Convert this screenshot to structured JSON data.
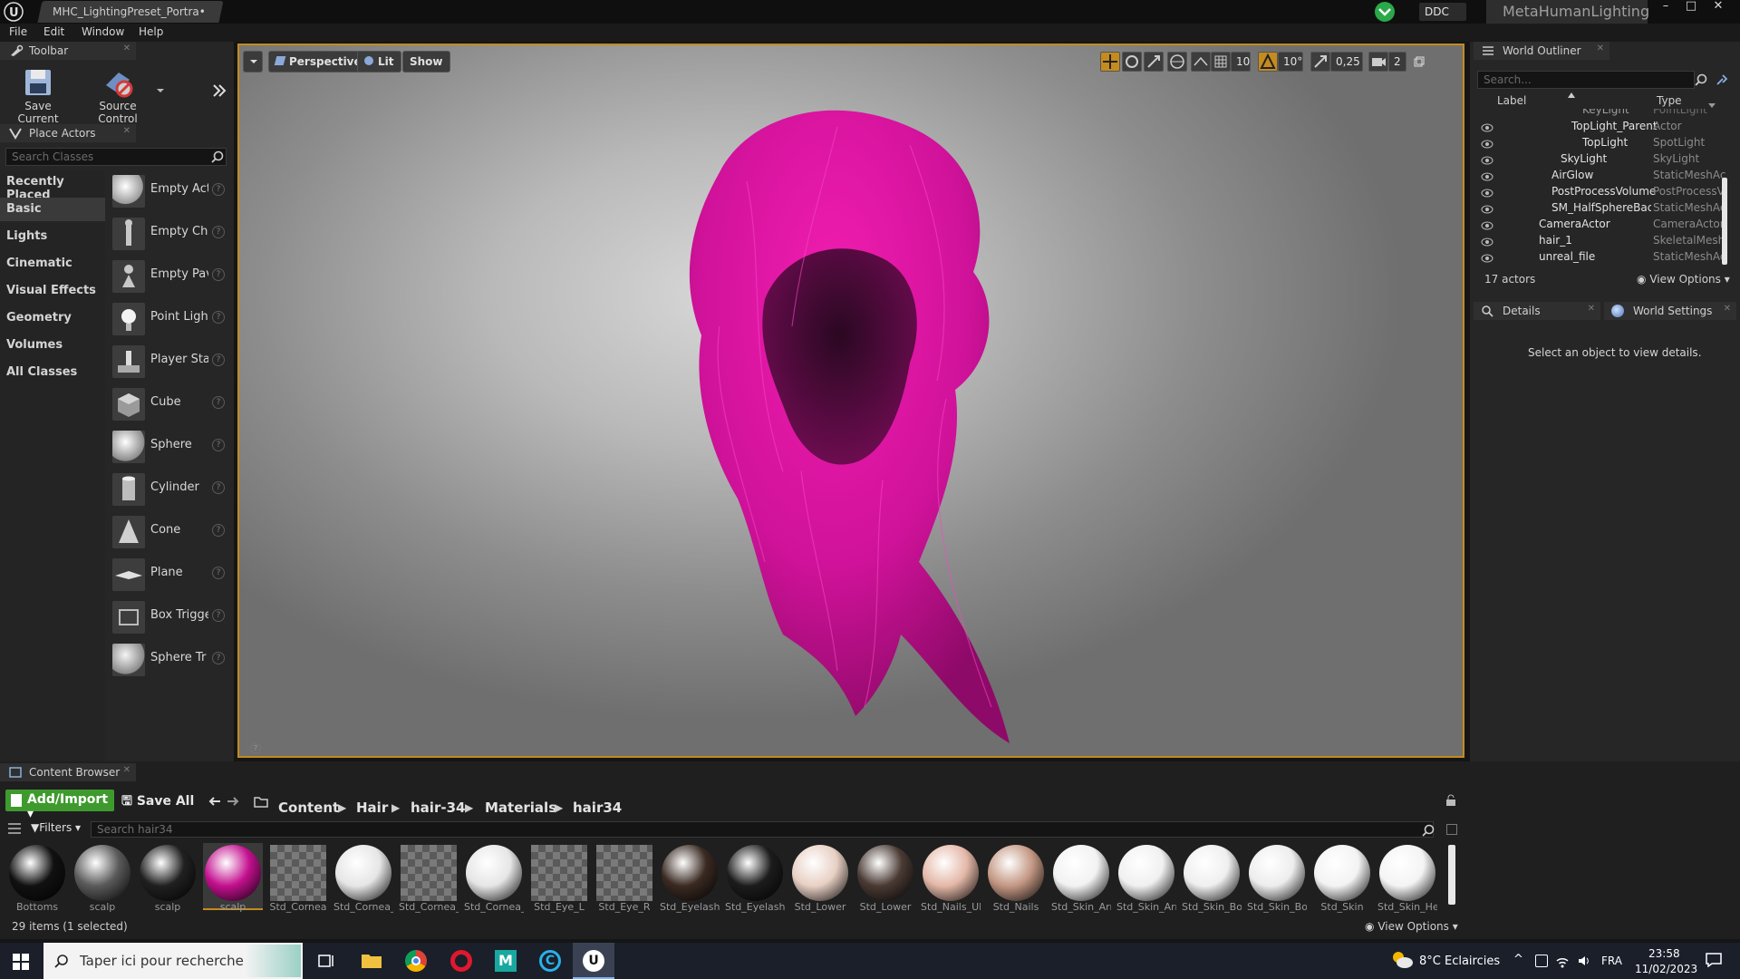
{
  "window": {
    "doc_tab": "MHC_LightingPreset_Portra•",
    "ddc": "DDC",
    "project": "MetaHumanLighting",
    "controls": [
      "–",
      "□",
      "✕"
    ]
  },
  "menu": [
    "File",
    "Edit",
    "Window",
    "Help"
  ],
  "toolbar": {
    "title": "Toolbar",
    "save_label": "Save Current",
    "source_label": "Source Control"
  },
  "place_actors": {
    "title": "Place Actors",
    "search_placeholder": "Search Classes",
    "categories": [
      "Recently Placed",
      "Basic",
      "Lights",
      "Cinematic",
      "Visual Effects",
      "Geometry",
      "Volumes",
      "All Classes"
    ],
    "selected_category": "Basic",
    "actors": [
      "Empty Act",
      "Empty Cha",
      "Empty Pav",
      "Point Light",
      "Player Sta",
      "Cube",
      "Sphere",
      "Cylinder",
      "Cone",
      "Plane",
      "Box Trigge",
      "Sphere Tr"
    ]
  },
  "viewport": {
    "perspective": "Perspective",
    "lit": "Lit",
    "show": "Show",
    "grid_snap": "10",
    "rot_snap": "10°",
    "scale_snap": "0,25",
    "cam_speed": "2",
    "hair_color": "#d0129a"
  },
  "outliner": {
    "title": "World Outliner",
    "search_placeholder": "Search...",
    "col_label": "Label",
    "col_type": "Type",
    "rows": [
      {
        "label": "KeyLight",
        "type": "PointLight"
      },
      {
        "label": "TopLight_Parent",
        "type": "Actor"
      },
      {
        "label": "TopLight",
        "type": "SpotLight"
      },
      {
        "label": "SkyLight",
        "type": "SkyLight"
      },
      {
        "label": "AirGlow",
        "type": "StaticMeshAc"
      },
      {
        "label": "PostProcessVolume",
        "type": "PostProcessV"
      },
      {
        "label": "SM_HalfSphereBackg",
        "type": "StaticMeshAc"
      },
      {
        "label": "CameraActor",
        "type": "CameraActor"
      },
      {
        "label": "hair_1",
        "type": "SkeletalMesh"
      },
      {
        "label": "unreal_file",
        "type": "StaticMeshAc"
      }
    ],
    "count": "17 actors",
    "view_options": "View Options"
  },
  "details": {
    "tab_details": "Details",
    "tab_world": "World Settings",
    "empty_msg": "Select an object to view details."
  },
  "content_browser": {
    "title": "Content Browser",
    "add_import": "Add/Import",
    "save_all": "Save All",
    "breadcrumb": [
      "Content",
      "Hair",
      "hair-34",
      "Materials",
      "hair34"
    ],
    "filters": "Filters",
    "search_placeholder": "Search hair34",
    "status": "29 items (1 selected)",
    "view_options": "View Options",
    "assets": [
      {
        "label": "Bottoms",
        "color": "#111111"
      },
      {
        "label": "scalp",
        "color": "#5a5a5a"
      },
      {
        "label": "scalp",
        "color": "#202020"
      },
      {
        "label": "scalp",
        "color": "#c4108f"
      },
      {
        "label": "Std_Cornea",
        "color": "checker"
      },
      {
        "label": "Std_Cornea_L",
        "color": "#e6e6e6"
      },
      {
        "label": "Std_Cornea_R",
        "color": "checker"
      },
      {
        "label": "Std_Cornea_R",
        "color": "#e6e6e6"
      },
      {
        "label": "Std_Eye_L",
        "color": "checker"
      },
      {
        "label": "Std_Eye_R",
        "color": "checker"
      },
      {
        "label": "Std_Eyelash",
        "color": "#3a2a22"
      },
      {
        "label": "Std_Eyelash",
        "color": "#1c1c1c"
      },
      {
        "label": "Std_Lower",
        "color": "#e8d0c4"
      },
      {
        "label": "Std_Lower",
        "color": "#4a3a34"
      },
      {
        "label": "Std_Nails_UP",
        "color": "#e4b8a8"
      },
      {
        "label": "Std_Nails",
        "color": "#c49884"
      },
      {
        "label": "Std_Skin_Arm",
        "color": "#f2f2f2"
      },
      {
        "label": "Std_Skin_Arm",
        "color": "#f0f0f0"
      },
      {
        "label": "Std_Skin_Body",
        "color": "#efefef"
      },
      {
        "label": "Std_Skin_Body",
        "color": "#ededed"
      },
      {
        "label": "Std_Skin",
        "color": "#f3f3f3"
      },
      {
        "label": "Std_Skin_Head",
        "color": "#f4f4f4"
      }
    ]
  },
  "taskbar": {
    "search_placeholder": "Taper ici pour rechercher",
    "weather": "8°C  Eclaircies",
    "lang": "FRA",
    "time": "23:58",
    "date": "11/02/2023"
  }
}
